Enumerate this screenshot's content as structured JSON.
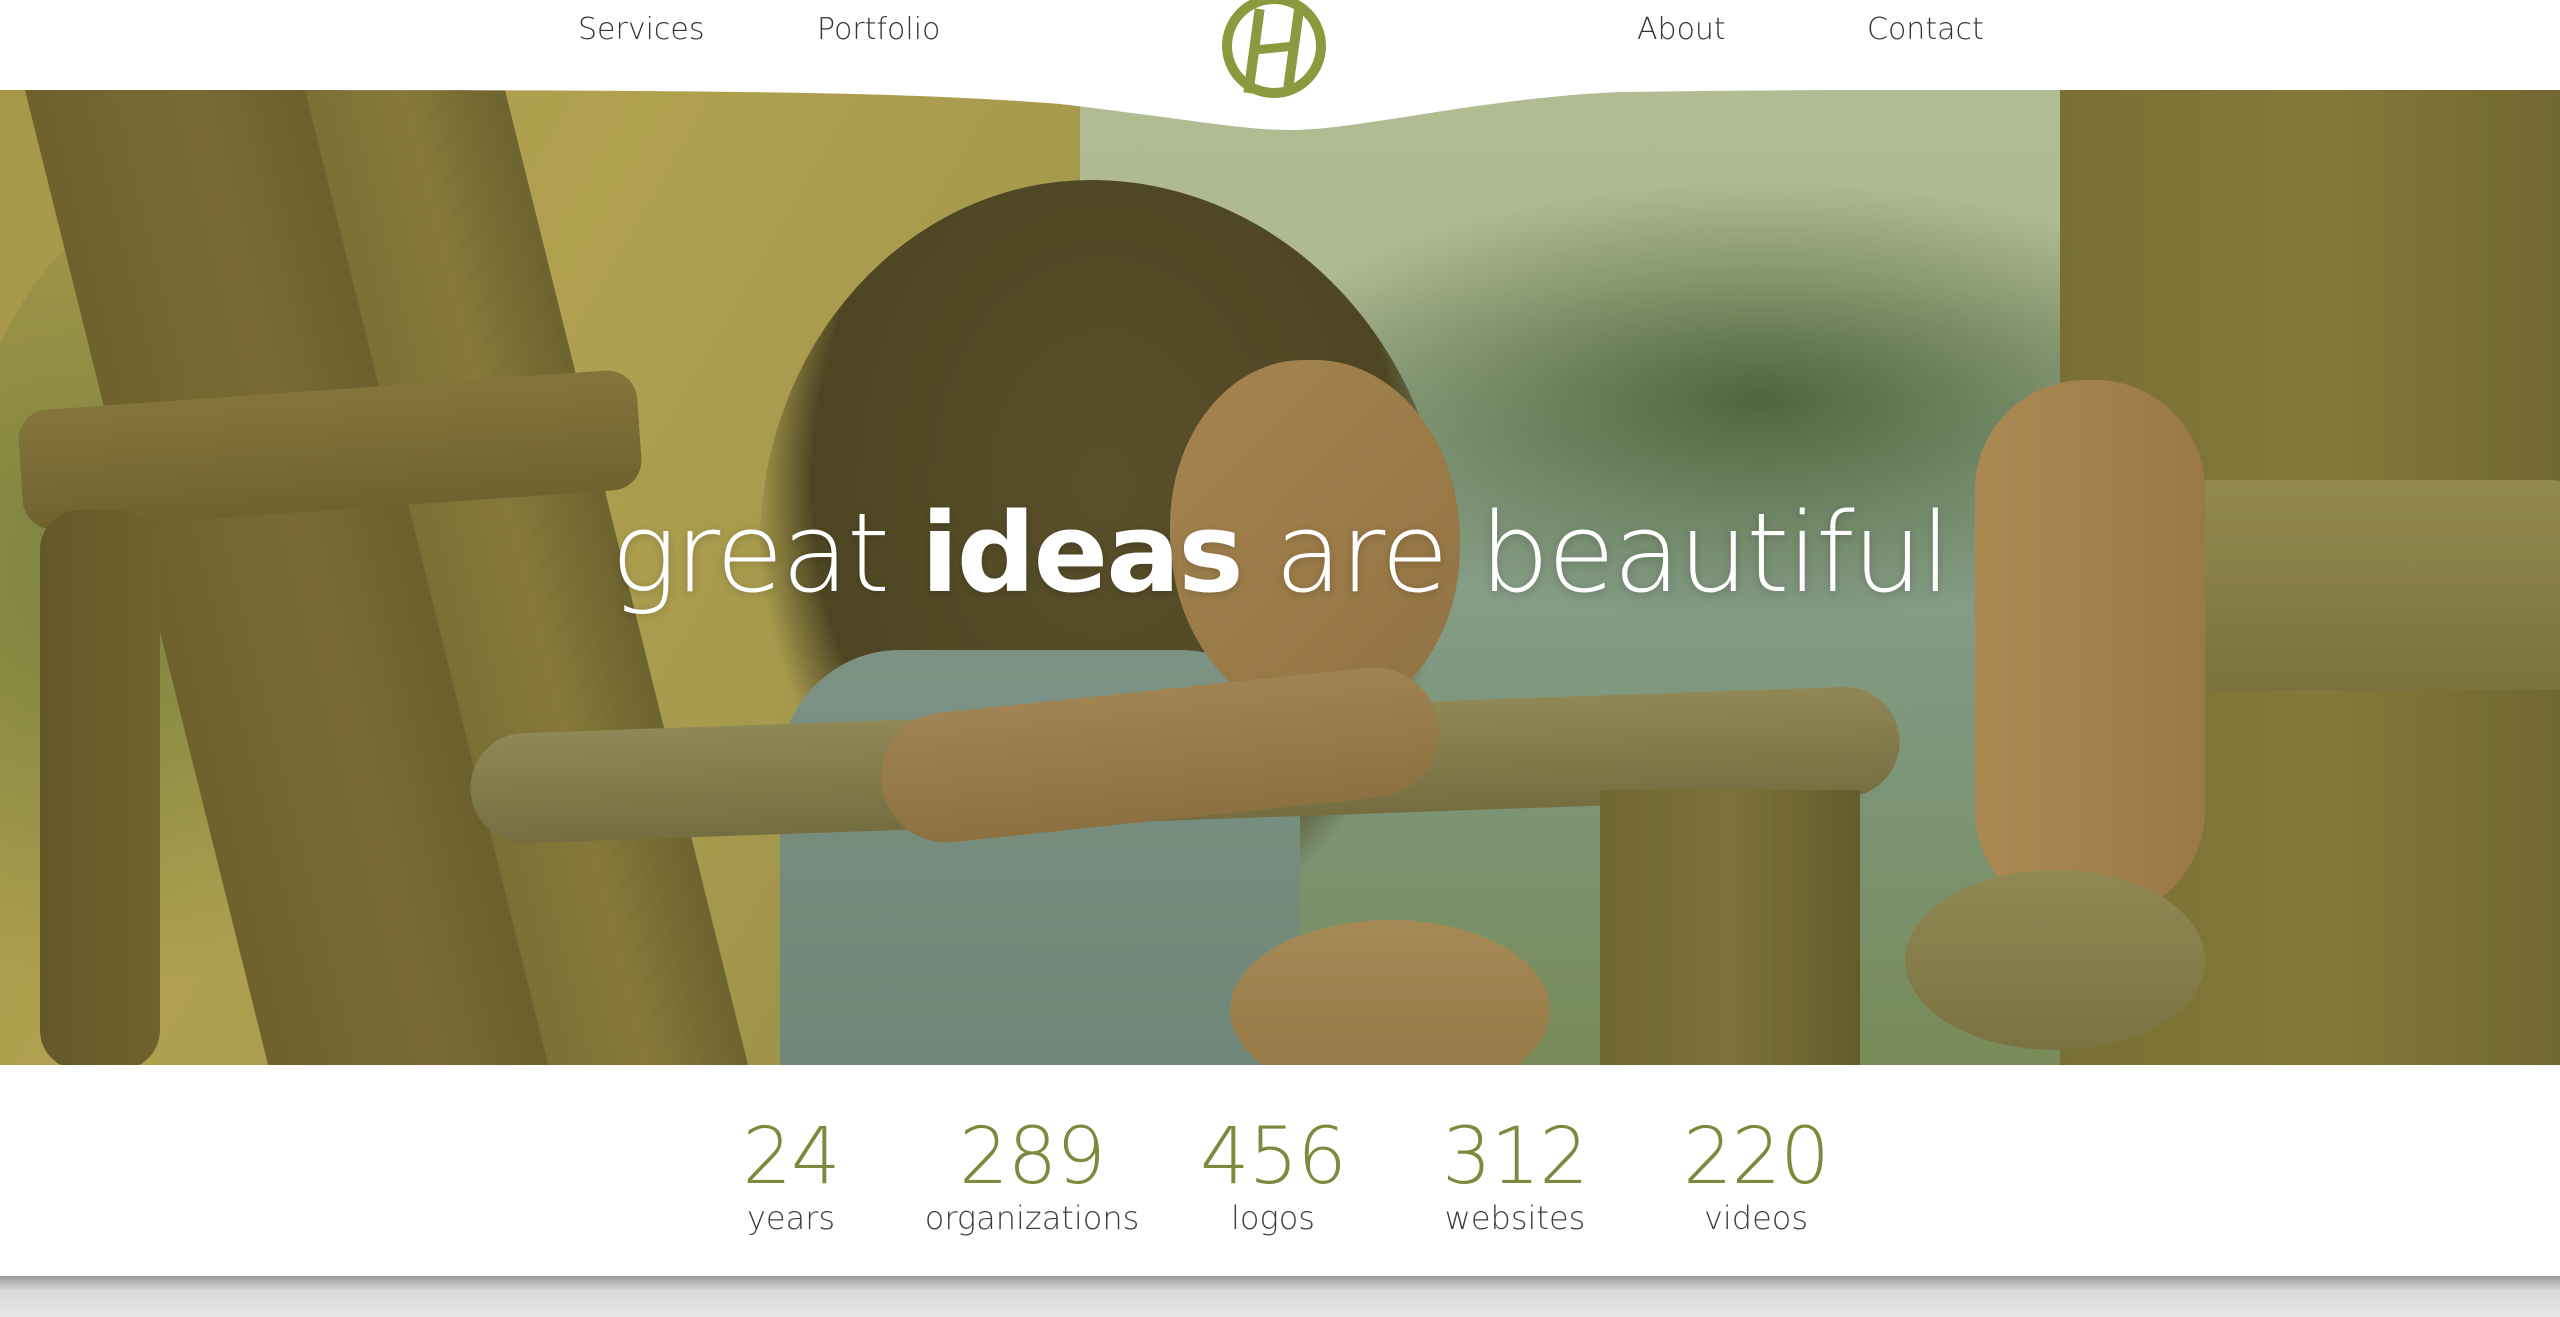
{
  "nav": {
    "services": "Services",
    "portfolio": "Portfolio",
    "about": "About",
    "contact": "Contact",
    "logo_letter": "H"
  },
  "hero": {
    "headline_part1": "great ",
    "headline_bold": "ideas",
    "headline_part2": " are beautiful"
  },
  "stats": [
    {
      "number": "24",
      "label": "years"
    },
    {
      "number": "289",
      "label": "organizations"
    },
    {
      "number": "456",
      "label": "logos"
    },
    {
      "number": "312",
      "label": "websites"
    },
    {
      "number": "220",
      "label": "videos"
    }
  ],
  "colors": {
    "brand_green": "#7b8a3c",
    "logo_green": "#8a9a3f",
    "text_dark": "#333333"
  },
  "icons": {
    "logo": "h-monogram-logo"
  }
}
